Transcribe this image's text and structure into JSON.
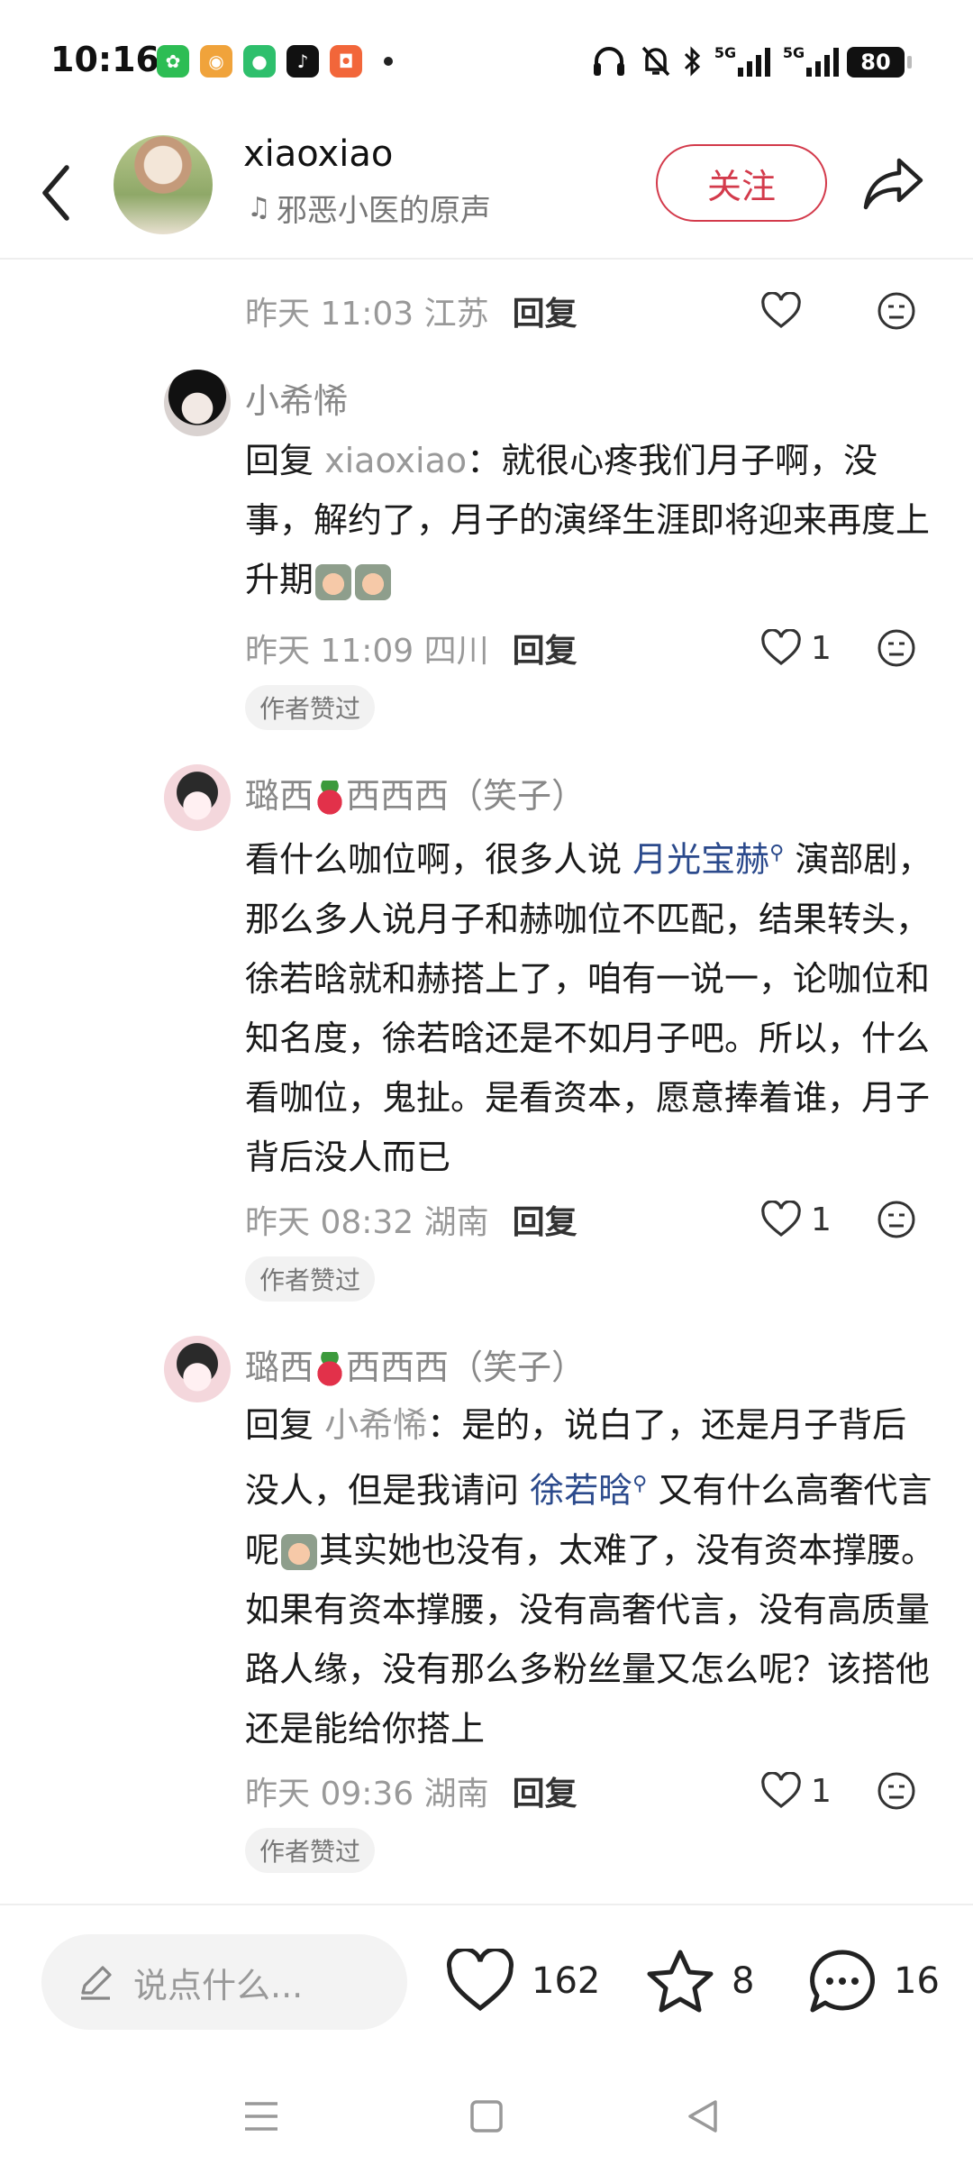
{
  "status_bar": {
    "time": "10:16",
    "apps": [
      {
        "icon": "wechat-icon",
        "color": "#2dbd54"
      },
      {
        "icon": "weibo-icon",
        "color": "#f0a33b"
      },
      {
        "icon": "green-app-icon",
        "color": "#2ebf6c"
      },
      {
        "icon": "tiktok-icon",
        "color": "#111111"
      },
      {
        "icon": "orange-app-icon",
        "color": "#f2663a"
      }
    ],
    "network_1": "5G",
    "network_2": "5G",
    "battery": "80"
  },
  "header": {
    "username": "xiaoxiao",
    "sound": "邪恶小医的原声",
    "follow_label": "关注"
  },
  "comments": [
    {
      "meta_time": "昨天 11:03 江苏",
      "reply_label": "回复"
    },
    {
      "username": "小希悕",
      "reply_prefix": "回复",
      "mention": "xiaoxiao",
      "text": "：就很心疼我们月子啊，没事，解约了，月子的演绎生涯即将迎来再度上升期",
      "meta_time": "昨天 11:09 四川",
      "reply_label": "回复",
      "likes": "1",
      "badge": "作者赞过"
    },
    {
      "username_a": "璐西",
      "username_b": "西西西（笑子）",
      "text_1": "看什么咖位啊，很多人说",
      "topic": "月光宝赫",
      "text_2": "演部剧，那么多人说月子和赫咖位不匹配，结果转头，徐若晗就和赫搭上了，咱有一说一，论咖位和知名度，徐若晗还是不如月子吧。所以，什么看咖位，鬼扯。是看资本，愿意捧着谁，月子背后没人而已",
      "meta_time": "昨天 08:32 湖南",
      "reply_label": "回复",
      "likes": "1",
      "badge": "作者赞过"
    },
    {
      "username_a": "璐西",
      "username_b": "西西西（笑子）",
      "reply_prefix": "回复",
      "mention": "小希悕",
      "text_1": "：是的，说白了，还是月子背后没人，但是我请问",
      "topic": "徐若晗",
      "text_2": "又有什么高奢代言呢",
      "text_3": "其实她也没有，太难了，没有资本撑腰。如果有资本撑腰，没有高奢代言，没有高质量路人缘，没有那么多粉丝量又怎么呢？该搭他还是能给你搭上",
      "meta_time": "昨天 09:36 湖南",
      "reply_label": "回复",
      "likes": "1",
      "badge": "作者赞过"
    }
  ],
  "bottom_bar": {
    "placeholder": "说点什么...",
    "likes": "162",
    "favorites": "8",
    "comments": "16"
  },
  "colors": {
    "accent": "#d33a4b",
    "topic_link": "#2b4a8c"
  }
}
